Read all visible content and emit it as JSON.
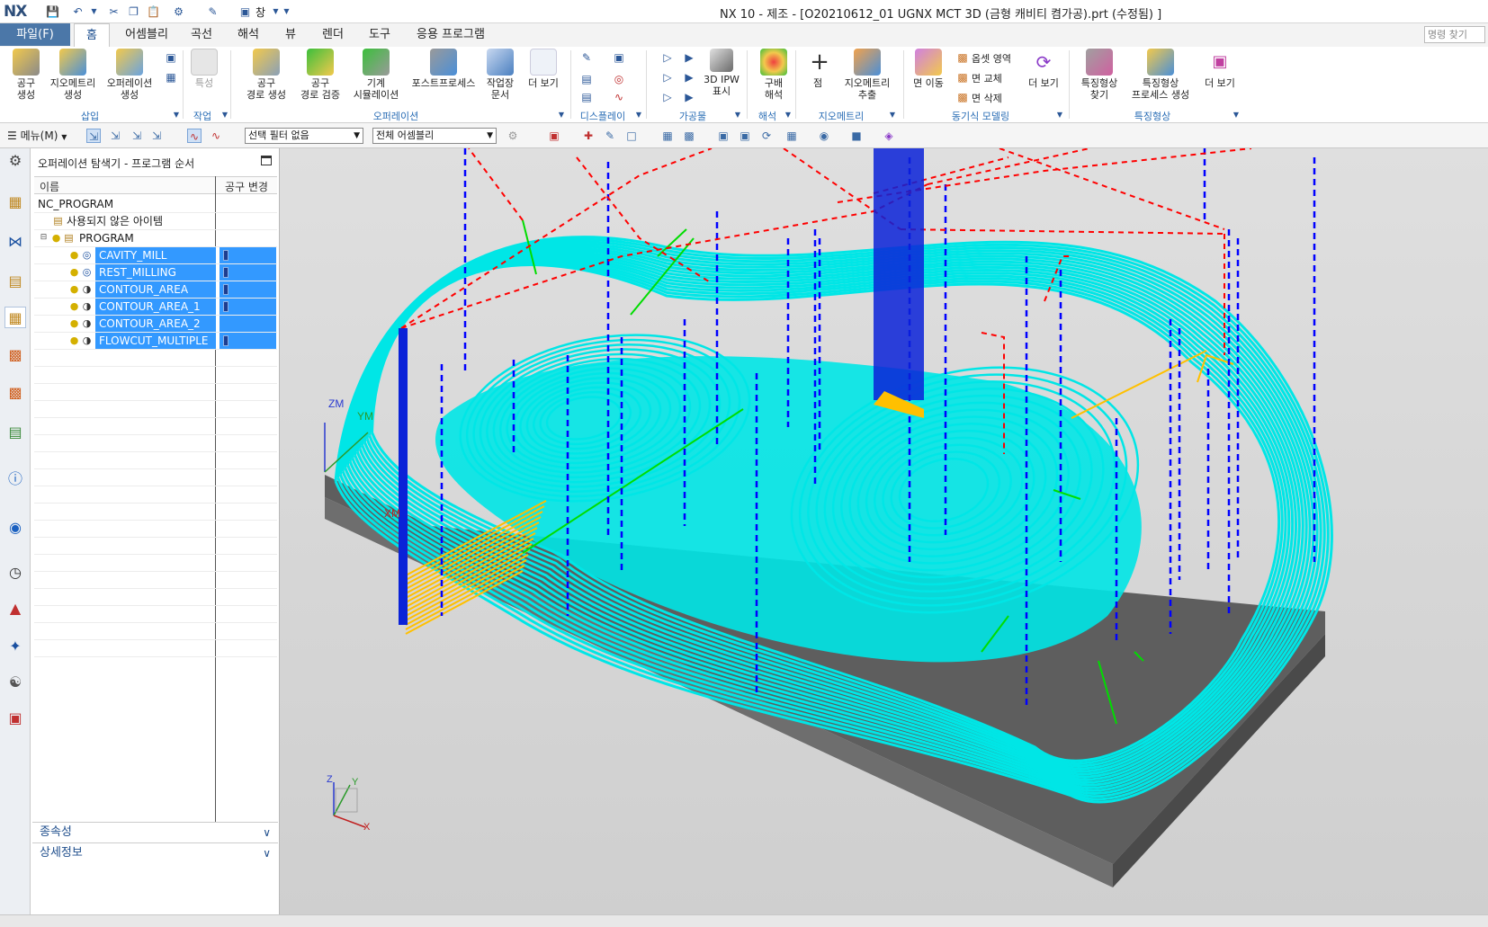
{
  "app": {
    "logo": "NX",
    "window_title": "NX 10 - 제조 - [O20210612_01 UGNX MCT 3D (금형 캐비티 켬가공).prt (수정됨) ]"
  },
  "quick_access": {
    "window_menu_label": "창"
  },
  "menu_tabs": {
    "file": "파일(F)",
    "items": [
      "홈",
      "어셈블리",
      "곡선",
      "해석",
      "뷰",
      "렌더",
      "도구",
      "응용 프로그램"
    ],
    "active_index": 0,
    "command_search_placeholder": "명령 찾기"
  },
  "ribbon": {
    "insert": {
      "label": "삽입",
      "buttons": [
        "공구\n생성",
        "지오메트리\n생성",
        "오퍼레이션\n생성"
      ]
    },
    "work": {
      "label": "작업",
      "buttons": [
        "특성"
      ]
    },
    "operation": {
      "label": "오퍼레이션",
      "buttons": [
        "공구\n경로 생성",
        "공구\n경로 검증",
        "기계\n시뮬레이션",
        "포스트프로세스",
        "작업장\n문서",
        "더 보기"
      ]
    },
    "display": {
      "label": "디스플레이"
    },
    "ipw": {
      "label": "가공물",
      "buttons": [
        "3D IPW\n표시"
      ]
    },
    "analysis": {
      "label": "해석",
      "buttons": [
        "구배\n해석"
      ]
    },
    "geometry": {
      "label": "지오메트리",
      "buttons": [
        "점",
        "지오메트리\n추출"
      ]
    },
    "sync": {
      "label": "동기식 모델링",
      "buttons": [
        "면 이동",
        "더 보기"
      ],
      "small_buttons": [
        "옵셋 영역",
        "면 교체",
        "면 삭제"
      ]
    },
    "feature": {
      "label": "특징형상",
      "buttons": [
        "특징형상\n찾기",
        "특징형상\n프로세스 생성",
        "더 보기"
      ]
    }
  },
  "selection_bar": {
    "menu_label": "메뉴(M)",
    "filter_value": "선택 필터 없음",
    "scope_value": "전체 어셈블리"
  },
  "navigator": {
    "title": "오퍼레이션 탐색기 - 프로그램 순서",
    "columns": [
      "이름",
      "공구 변경"
    ],
    "root": "NC_PROGRAM",
    "unused": "사용되지 않은 아이템",
    "program": "PROGRAM",
    "operations": [
      {
        "name": "CAVITY_MILL",
        "tool_change": true
      },
      {
        "name": "REST_MILLING",
        "tool_change": true
      },
      {
        "name": "CONTOUR_AREA",
        "tool_change": true
      },
      {
        "name": "CONTOUR_AREA_1",
        "tool_change": true
      },
      {
        "name": "CONTOUR_AREA_2",
        "tool_change": false
      },
      {
        "name": "FLOWCUT_MULTIPLE",
        "tool_change": true
      }
    ],
    "sections": [
      "종속성",
      "상세정보"
    ]
  },
  "viewport": {
    "csys_labels": [
      "ZM",
      "YM",
      "XM"
    ],
    "triad_labels": [
      "Z",
      "Y",
      "X"
    ],
    "colors": {
      "toolpath": "#00e6e6",
      "rapid": "#ff0000",
      "engage": "#0000ff",
      "cut_engage": "#ffc000",
      "approach": "#00dd00",
      "stock": "#6e6e6e",
      "background": "#d8d8d8"
    }
  }
}
